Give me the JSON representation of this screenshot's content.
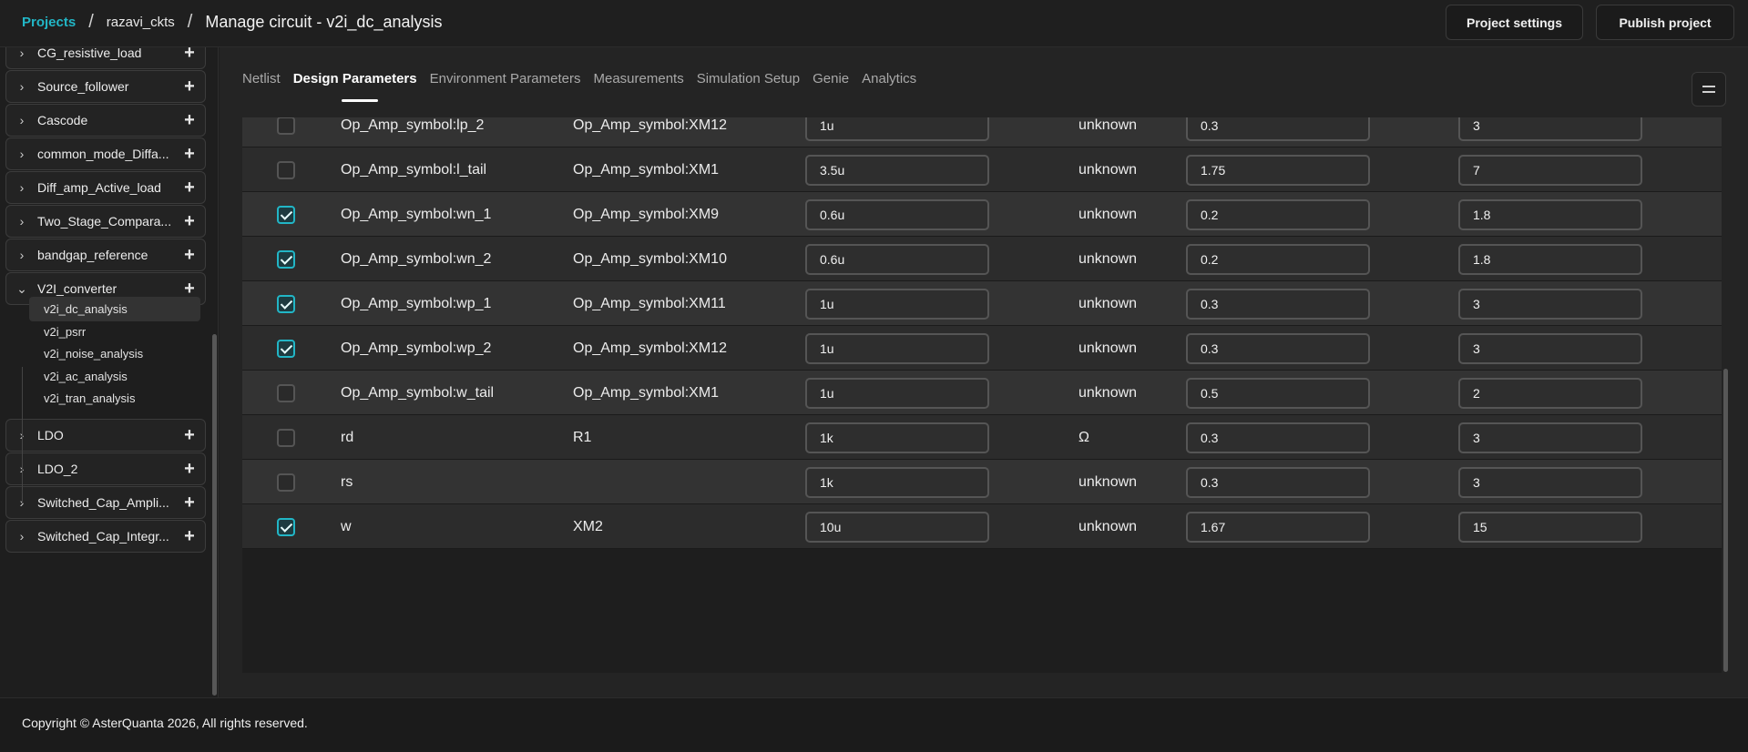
{
  "header": {
    "breadcrumb_projects": "Projects",
    "breadcrumb_project": "razavi_ckts",
    "separator": "/",
    "page_title": "Manage circuit - v2i_dc_analysis",
    "project_settings_label": "Project settings",
    "publish_label": "Publish project"
  },
  "sidebar": {
    "groups": [
      {
        "label": "CG_resistive_load",
        "expanded": false
      },
      {
        "label": "Source_follower",
        "expanded": false
      },
      {
        "label": "Cascode",
        "expanded": false
      },
      {
        "label": "common_mode_Diffa...",
        "expanded": false
      },
      {
        "label": "Diff_amp_Active_load",
        "expanded": false
      },
      {
        "label": "Two_Stage_Compara...",
        "expanded": false
      },
      {
        "label": "bandgap_reference",
        "expanded": false
      },
      {
        "label": "V2I_converter",
        "expanded": true
      },
      {
        "label": "LDO",
        "expanded": false
      },
      {
        "label": "LDO_2",
        "expanded": false
      },
      {
        "label": "Switched_Cap_Ampli...",
        "expanded": false
      },
      {
        "label": "Switched_Cap_Integr...",
        "expanded": false
      }
    ],
    "subitems": [
      {
        "label": "v2i_dc_analysis",
        "active": true
      },
      {
        "label": "v2i_psrr",
        "active": false
      },
      {
        "label": "v2i_noise_analysis",
        "active": false
      },
      {
        "label": "v2i_ac_analysis",
        "active": false
      },
      {
        "label": "v2i_tran_analysis",
        "active": false
      }
    ]
  },
  "tabs": [
    {
      "label": "Netlist",
      "active": false
    },
    {
      "label": "Design Parameters",
      "active": true
    },
    {
      "label": "Environment Parameters",
      "active": false
    },
    {
      "label": "Measurements",
      "active": false
    },
    {
      "label": "Simulation Setup",
      "active": false
    },
    {
      "label": "Genie",
      "active": false
    },
    {
      "label": "Analytics",
      "active": false
    }
  ],
  "parameters": [
    {
      "checked": false,
      "name": "Op_Amp_symbol:lp_2",
      "device": "Op_Amp_symbol:XM12",
      "value": "1u",
      "unit": "unknown",
      "min": "0.3",
      "max": "3"
    },
    {
      "checked": false,
      "name": "Op_Amp_symbol:l_tail",
      "device": "Op_Amp_symbol:XM1",
      "value": "3.5u",
      "unit": "unknown",
      "min": "1.75",
      "max": "7"
    },
    {
      "checked": true,
      "name": "Op_Amp_symbol:wn_1",
      "device": "Op_Amp_symbol:XM9",
      "value": "0.6u",
      "unit": "unknown",
      "min": "0.2",
      "max": "1.8"
    },
    {
      "checked": true,
      "name": "Op_Amp_symbol:wn_2",
      "device": "Op_Amp_symbol:XM10",
      "value": "0.6u",
      "unit": "unknown",
      "min": "0.2",
      "max": "1.8"
    },
    {
      "checked": true,
      "name": "Op_Amp_symbol:wp_1",
      "device": "Op_Amp_symbol:XM11",
      "value": "1u",
      "unit": "unknown",
      "min": "0.3",
      "max": "3"
    },
    {
      "checked": true,
      "name": "Op_Amp_symbol:wp_2",
      "device": "Op_Amp_symbol:XM12",
      "value": "1u",
      "unit": "unknown",
      "min": "0.3",
      "max": "3"
    },
    {
      "checked": false,
      "name": "Op_Amp_symbol:w_tail",
      "device": "Op_Amp_symbol:XM1",
      "value": "1u",
      "unit": "unknown",
      "min": "0.5",
      "max": "2"
    },
    {
      "checked": false,
      "name": "rd",
      "device": "R1",
      "value": "1k",
      "unit": "Ω",
      "min": "0.3",
      "max": "3"
    },
    {
      "checked": false,
      "name": "rs",
      "device": "",
      "value": "1k",
      "unit": "unknown",
      "min": "0.3",
      "max": "3"
    },
    {
      "checked": true,
      "name": "w",
      "device": "XM2",
      "value": "10u",
      "unit": "unknown",
      "min": "1.67",
      "max": "15"
    }
  ],
  "footer": {
    "copyright": "Copyright © AsterQuanta 2026, All rights reserved."
  },
  "colors": {
    "accent": "#22b6c6",
    "background": "#1e1e1e"
  }
}
